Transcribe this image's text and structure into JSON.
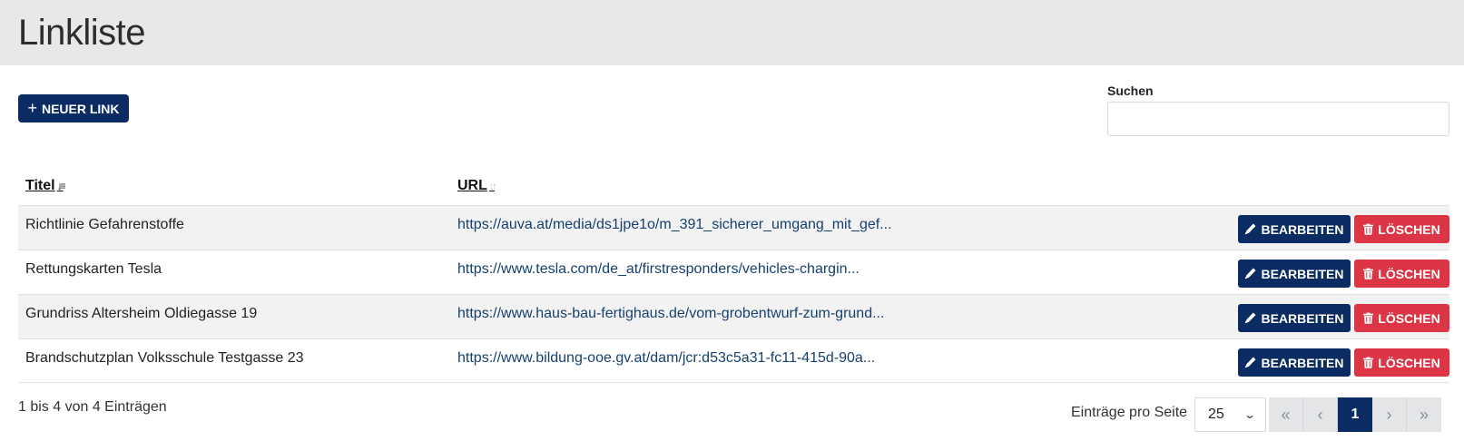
{
  "header": {
    "title": "Linkliste"
  },
  "toolbar": {
    "new_link_label": "NEUER LINK"
  },
  "search": {
    "label": "Suchen",
    "value": "",
    "placeholder": ""
  },
  "table": {
    "columns": [
      {
        "label": "Titel",
        "sort": "descending"
      },
      {
        "label": "URL",
        "sort": "none"
      }
    ],
    "rows": [
      {
        "title": "Richtlinie Gefahrenstoffe",
        "url": "https://auva.at/media/ds1jpe1o/m_391_sicherer_umgang_mit_gef..."
      },
      {
        "title": "Rettungskarten Tesla",
        "url": "https://www.tesla.com/de_at/firstresponders/vehicles-chargin..."
      },
      {
        "title": "Grundriss Altersheim Oldiegasse 19",
        "url": "https://www.haus-bau-fertighaus.de/vom-grobentwurf-zum-grund..."
      },
      {
        "title": "Brandschutzplan Volksschule Testgasse 23",
        "url": "https://www.bildung-ooe.gv.at/dam/jcr:d53c5a31-fc11-415d-90a..."
      }
    ],
    "edit_label": "BEARBEITEN",
    "delete_label": "LÖSCHEN"
  },
  "footer": {
    "info": "1 bis 4 von 4 Einträgen",
    "per_page_label": "Einträge pro Seite",
    "per_page_value": "25",
    "current_page": "1"
  },
  "colors": {
    "primary": "#0b2c63",
    "danger": "#dc3545",
    "header_bg": "#e8e8e8",
    "link": "#16406f"
  }
}
